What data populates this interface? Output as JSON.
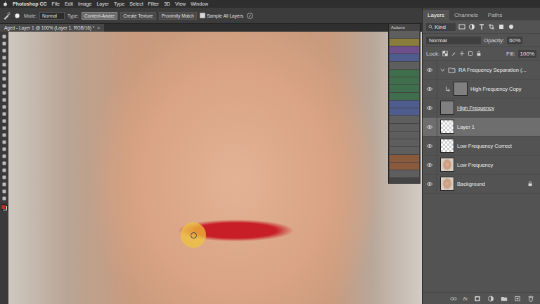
{
  "menubar": {
    "app": "Photoshop CC",
    "items": [
      "File",
      "Edit",
      "Image",
      "Layer",
      "Type",
      "Select",
      "Filter",
      "3D",
      "View",
      "Window"
    ]
  },
  "options_bar": {
    "mode_label": "Mode:",
    "mode": "Normal",
    "type_label": "Type:",
    "types": [
      {
        "label": "Content-Aware",
        "selected": true
      },
      {
        "label": "Create Texture",
        "selected": false
      },
      {
        "label": "Proximity Match",
        "selected": false
      }
    ],
    "sample_all": {
      "label": "Sample All Layers",
      "checked": true
    }
  },
  "document_tab": {
    "title": "Aged - Layer 1 @ 100% (Layer 1, RGB/16) *",
    "close": "×"
  },
  "toolbar": {
    "foreground_color": "#b3322a",
    "background_color": "#ffffff"
  },
  "actions_panel": {
    "title": "Actions",
    "rows": [
      {
        "color": "#5e5e5e"
      },
      {
        "color": "#8a7d3c"
      },
      {
        "color": "#6e4f8c"
      },
      {
        "color": "#4e5d8e"
      },
      {
        "color": "#5e5e5e"
      },
      {
        "color": "#3f6e4c"
      },
      {
        "color": "#3f6e4c"
      },
      {
        "color": "#3f6e4c"
      },
      {
        "color": "#3f6e4c"
      },
      {
        "color": "#4e5d8e"
      },
      {
        "color": "#4e5d8e"
      },
      {
        "color": "#5e5e5e"
      },
      {
        "color": "#5e5e5e"
      },
      {
        "color": "#5e5e5e"
      },
      {
        "color": "#5e5e5e"
      },
      {
        "color": "#5e5e5e"
      },
      {
        "color": "#8a5a3c"
      },
      {
        "color": "#8a5a3c"
      },
      {
        "color": "#5e5e5e"
      }
    ]
  },
  "layers_panel": {
    "tabs": [
      {
        "label": "Layers",
        "selected": true
      },
      {
        "label": "Channels",
        "selected": false
      },
      {
        "label": "Paths",
        "selected": false
      }
    ],
    "filter": "Kind",
    "blend_mode": "Normal",
    "opacity_label": "Opacity:",
    "opacity": "60%",
    "lock_label": "Lock:",
    "fill_label": "Fill:",
    "fill": "100%",
    "layers": [
      {
        "name": "RA Frequency Separation (...",
        "kind": "group",
        "visible": true,
        "selected": false,
        "expanded": true,
        "thumbnail": "none",
        "clip_base": false,
        "locked": false
      },
      {
        "name": "High Frequency Copy",
        "kind": "clipped",
        "visible": true,
        "selected": false,
        "expanded": false,
        "thumbnail": "gray",
        "clip_base": false,
        "locked": false
      },
      {
        "name": "High Frequency",
        "kind": "layer",
        "visible": true,
        "selected": false,
        "expanded": false,
        "thumbnail": "gray",
        "clip_base": true,
        "locked": false
      },
      {
        "name": "Layer 1",
        "kind": "layer",
        "visible": true,
        "selected": true,
        "expanded": false,
        "thumbnail": "transparent",
        "clip_base": false,
        "locked": false
      },
      {
        "name": "Low Frequency Correct",
        "kind": "layer",
        "visible": true,
        "selected": false,
        "expanded": false,
        "thumbnail": "transparent",
        "clip_base": false,
        "locked": false
      },
      {
        "name": "Low Frequency",
        "kind": "layer",
        "visible": true,
        "selected": false,
        "expanded": false,
        "thumbnail": "photo",
        "clip_base": false,
        "locked": false
      },
      {
        "name": "Background",
        "kind": "background",
        "visible": true,
        "selected": false,
        "expanded": false,
        "thumbnail": "photo",
        "clip_base": false,
        "locked": true
      }
    ],
    "footer_fx": "fx"
  }
}
